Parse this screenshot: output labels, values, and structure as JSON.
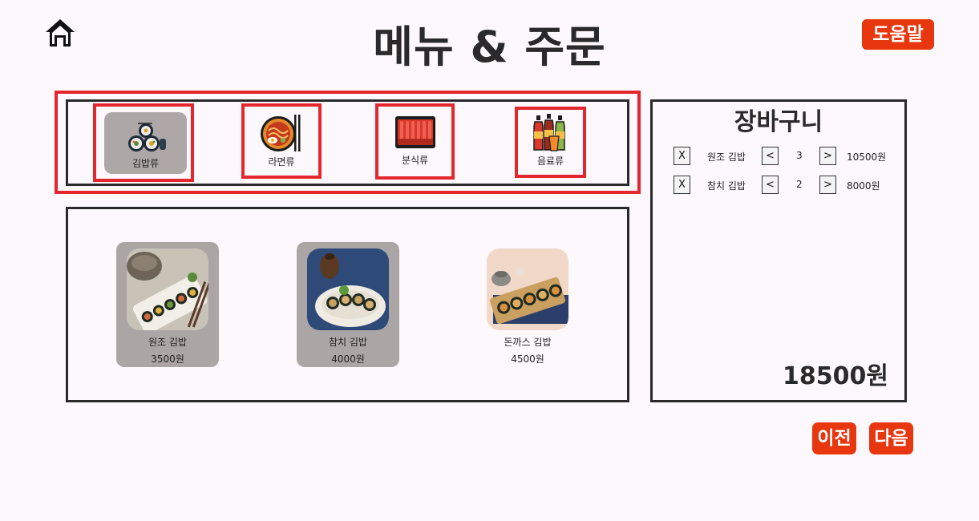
{
  "header": {
    "title": "메뉴 & 주문",
    "help_label": "도움말"
  },
  "categories": [
    {
      "label": "김밥류",
      "icon": "gimbap-icon",
      "active": true
    },
    {
      "label": "라면류",
      "icon": "ramen-icon",
      "active": false
    },
    {
      "label": "분식류",
      "icon": "tteokbokki-icon",
      "active": false
    },
    {
      "label": "음료류",
      "icon": "drinks-icon",
      "active": false
    }
  ],
  "menu_items": [
    {
      "name": "원조 김밥",
      "price": "3500원",
      "selected": true
    },
    {
      "name": "참치 김밥",
      "price": "4000원",
      "selected": true
    },
    {
      "name": "돈까스 김밥",
      "price": "4500원",
      "selected": false
    }
  ],
  "cart": {
    "title": "장바구니",
    "remove_label": "X",
    "decrease_label": "<",
    "increase_label": ">",
    "items": [
      {
        "name": "원조 김밥",
        "qty": "3",
        "subtotal": "10500원"
      },
      {
        "name": "참치 김밥",
        "qty": "2",
        "subtotal": "8000원"
      }
    ],
    "total": "18500원"
  },
  "nav": {
    "prev_label": "이전",
    "next_label": "다음"
  },
  "colors": {
    "accent": "#e8360f",
    "highlight_border": "#e4262f",
    "selected_bg": "#aba5a5",
    "background": "#fdf8fb"
  }
}
